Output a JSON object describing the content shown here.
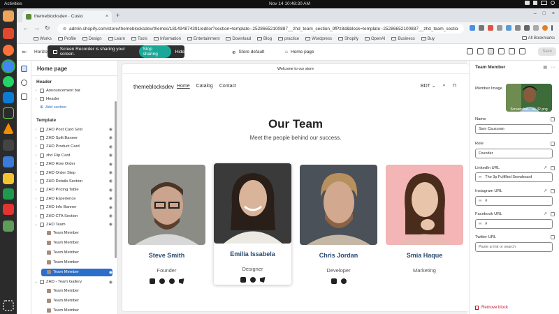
{
  "os": {
    "activities": "Activities",
    "clock": "Nov 14  10:48:30 AM",
    "system_icons": [
      "network-icon",
      "volume-icon",
      "battery-icon",
      "power-icon"
    ]
  },
  "dock": {
    "apps": [
      "files-icon",
      "app-icon",
      "firefox-icon",
      "chrome-icon",
      "whatsapp-icon",
      "vscode-icon",
      "upwork-icon",
      "vlc-icon",
      "terminal-icon",
      "notes-icon",
      "spreadsheet-icon",
      "anydesk-icon",
      "trash-icon",
      "apps-grid-icon"
    ]
  },
  "browser": {
    "tab_title": "themeblocksdev · Custo",
    "new_tab": "+",
    "window_controls": [
      "–",
      "□",
      "×"
    ],
    "url": "admin.shopify.com/store/themeblocksdev/themes/181494874391/editor?section=template--25286652100887__zhd_team_section_9fPz8d&block=template--25286652100887__zhd_team_section_9fPz8d_...",
    "bookmarks": [
      "Works",
      "Profile",
      "Design",
      "Learn",
      "Tools",
      "Information",
      "Entertainment",
      "Download",
      "Blog",
      "practice",
      "Wordpress",
      "Shopify",
      "OpenAI",
      "Business",
      "Buy"
    ],
    "all_bookmarks": "All Bookmarks"
  },
  "editor": {
    "horizon_label": "Horizo",
    "screen_recorder": {
      "message": "Screen Recorder is sharing your screen.",
      "stop": "Stop sharing",
      "hide": "Hide"
    },
    "store_default": "Store default",
    "home_page": "Home page",
    "save": "Save"
  },
  "left_panel": {
    "title": "Home page",
    "header_section": "Header",
    "header_items": [
      {
        "label": "Announcement bar",
        "icon": "layout-icon"
      },
      {
        "label": "Header",
        "icon": "layout-icon"
      },
      {
        "label": "Add section",
        "icon": "plus-circle-icon"
      }
    ],
    "template_section": "Template",
    "template_items": [
      {
        "label": "ZHD Post Card Grid"
      },
      {
        "label": "ZHD Split Banner"
      },
      {
        "label": "ZHD Product Card"
      },
      {
        "label": "zhd Flip Card"
      },
      {
        "label": "ZHD How Order"
      },
      {
        "label": "ZHD Order Step"
      },
      {
        "label": "ZHD Details Section"
      },
      {
        "label": "ZHD Pricing Table"
      },
      {
        "label": "ZHD Experience"
      },
      {
        "label": "ZHD Info Banner"
      },
      {
        "label": "ZHD CTA Section"
      },
      {
        "label": "ZHD Team"
      },
      {
        "label": "Team Member"
      },
      {
        "label": "Team Member"
      },
      {
        "label": "Team Member"
      },
      {
        "label": "Team Member"
      },
      {
        "label": "Team Member"
      },
      {
        "label": "ZHD - Team Gallery"
      },
      {
        "label": "Team Member"
      },
      {
        "label": "Team Member"
      },
      {
        "label": "Team Member"
      }
    ],
    "selected_index": 16
  },
  "preview": {
    "announcement": "Welcome to our store",
    "logo": "themeblocksdev",
    "nav": [
      "Home",
      "Catalog",
      "Contact"
    ],
    "currency": "BDT",
    "heading": "Our Team",
    "subheading": "Meet the people behind our success.",
    "members": [
      {
        "name": "Steve Smith",
        "role": "Founder",
        "social": [
          "linkedin-icon",
          "instagram-icon",
          "facebook-icon",
          "twitter-icon"
        ],
        "photo_bg": "#8c8c86"
      },
      {
        "name": "Emilia Issabela",
        "role": "Designer",
        "social": [
          "linkedin-icon",
          "facebook-icon",
          "twitter-icon"
        ],
        "photo_bg": "#3a3a3a"
      },
      {
        "name": "Chris Jordan",
        "role": "Developer",
        "social": [
          "linkedin-icon",
          "facebook-icon"
        ],
        "photo_bg": "#4b5158"
      },
      {
        "name": "Smia Haque",
        "role": "Marketing",
        "social": [],
        "photo_bg": "#f3b5b5"
      }
    ]
  },
  "right_panel": {
    "title": "Team Member",
    "member_image_label": "Member Image",
    "member_image_caption": "Screenshot... 44-32.png",
    "name_label": "Name",
    "name_value": "Sam Causuran",
    "role_label": "Role",
    "role_value": "Founder",
    "linkedin_label": "LinkedIn URL",
    "linkedin_value": "The 3p Fulfilled Snowboard",
    "instagram_label": "Instagram URL",
    "instagram_value": "#",
    "facebook_label": "Facebook URL",
    "facebook_value": "#",
    "twitter_label": "Twitter URL",
    "twitter_placeholder": "Paste a link or search",
    "remove_block": "Remove block"
  },
  "colors": {
    "accent": "#2c6ecb",
    "stop_button": "#1aa999",
    "name_text": "#2b4a6f",
    "danger": "#c0172d"
  }
}
